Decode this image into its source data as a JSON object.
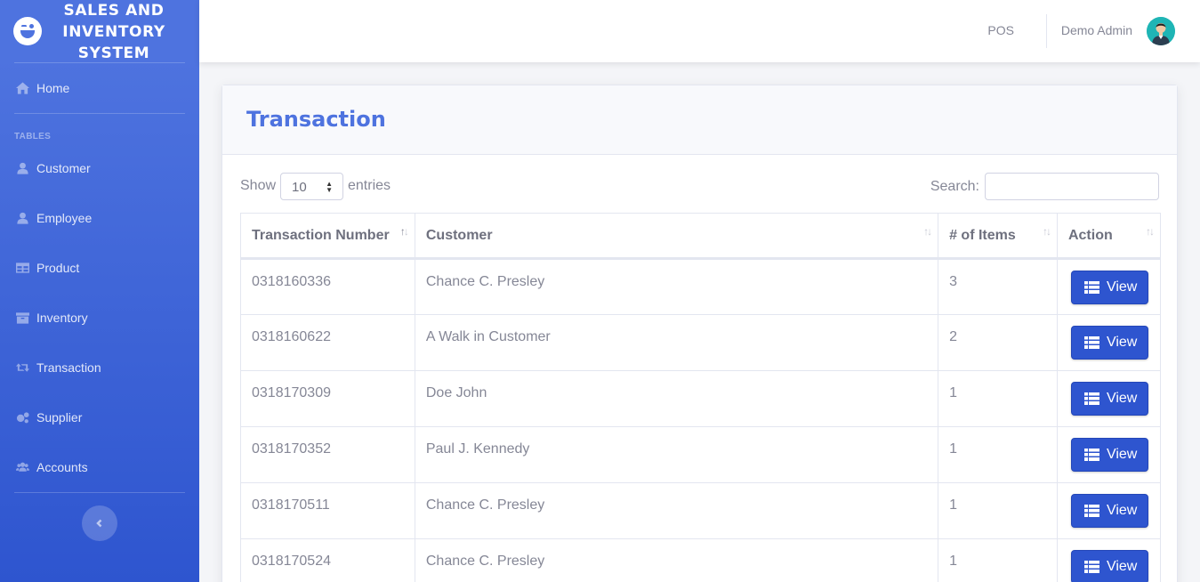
{
  "sidebar": {
    "brand": "SALES AND INVENTORY SYSTEM",
    "home": {
      "label": "Home",
      "icon": "home-icon"
    },
    "heading": "TABLES",
    "items": [
      {
        "label": "Customer",
        "icon": "user-icon"
      },
      {
        "label": "Employee",
        "icon": "user-icon"
      },
      {
        "label": "Product",
        "icon": "table-icon"
      },
      {
        "label": "Inventory",
        "icon": "archive-icon"
      },
      {
        "label": "Transaction",
        "icon": "retweet-icon"
      },
      {
        "label": "Supplier",
        "icon": "cogs-icon"
      },
      {
        "label": "Accounts",
        "icon": "users-icon"
      }
    ]
  },
  "topbar": {
    "pos": "POS",
    "user": "Demo Admin"
  },
  "card": {
    "title": "Transaction"
  },
  "controls": {
    "show": "Show",
    "entries_value": "10",
    "entries": "entries",
    "search": "Search:",
    "search_value": ""
  },
  "table": {
    "headers": [
      "Transaction Number",
      "Customer",
      "# of Items",
      "Action"
    ],
    "view_label": "View",
    "rows": [
      {
        "number": "0318160336",
        "customer": "Chance C. Presley",
        "items": "3"
      },
      {
        "number": "0318160622",
        "customer": "A Walk in Customer",
        "items": "2"
      },
      {
        "number": "0318170309",
        "customer": "Doe John",
        "items": "1"
      },
      {
        "number": "0318170352",
        "customer": "Paul J. Kennedy",
        "items": "1"
      },
      {
        "number": "0318170511",
        "customer": "Chance C. Presley",
        "items": "1"
      },
      {
        "number": "0318170524",
        "customer": "Chance C. Presley",
        "items": "1"
      }
    ]
  },
  "colors": {
    "primary": "#4e73df",
    "sidebar_bottom": "#2e55cf",
    "text": "#858796"
  }
}
